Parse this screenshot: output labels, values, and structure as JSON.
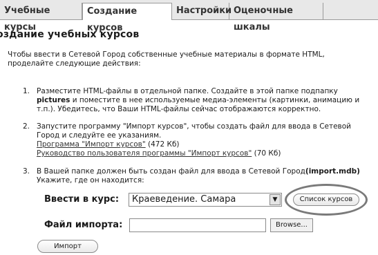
{
  "tabs": [
    {
      "label": "Учебные курсы"
    },
    {
      "label": "Создание курсов"
    },
    {
      "label": "Настройки"
    },
    {
      "label": "Оценочные шкалы"
    }
  ],
  "page_title": "оздание учебных курсов",
  "intro": [
    "Чтобы ввести в Сетевой Город собственные учебные материалы в формате HTML,",
    "проделайте следующие действия:"
  ],
  "steps": [
    {
      "number": "1.",
      "lines": [
        "Разместите HTML-файлы в отдельной папке. Создайте в этой папке подпапку",
        "и поместите в нее используемые медиа-элементы (картинки, анимацию и",
        "т.п.). Убедитесь, что Ваши HTML-файлы сейчас отображаются корректно."
      ],
      "bold_word": "pictures"
    },
    {
      "number": "2.",
      "lines": [
        "Запустите программу \"Импорт курсов\", чтобы создать файл для ввода в Сетевой",
        "Город и следуйте ее указаниям."
      ],
      "link1_text": "Программа \"Импорт курсов\"",
      "link1_size": "(472 Кб)",
      "link2_text": "Руководство пользователя программы \"Импорт курсов\"",
      "link2_size": "(70 Кб)"
    },
    {
      "number": "3.",
      "line1": "В Вашей папке должен быть создан файл для ввода в Сетевой Город",
      "bold_file": "(import.mdb)",
      "line2": "Укажите, где он находится:"
    }
  ],
  "form": {
    "course_label": "Ввести в курс:",
    "course_value": "Краеведение. Самара",
    "course_list_button": "Список курсов",
    "file_label": "Файл импорта:",
    "file_value": "",
    "browse_button": "Browse...",
    "import_button": "Импорт"
  },
  "icons": {
    "dropdown": "chevron-down-icon"
  }
}
